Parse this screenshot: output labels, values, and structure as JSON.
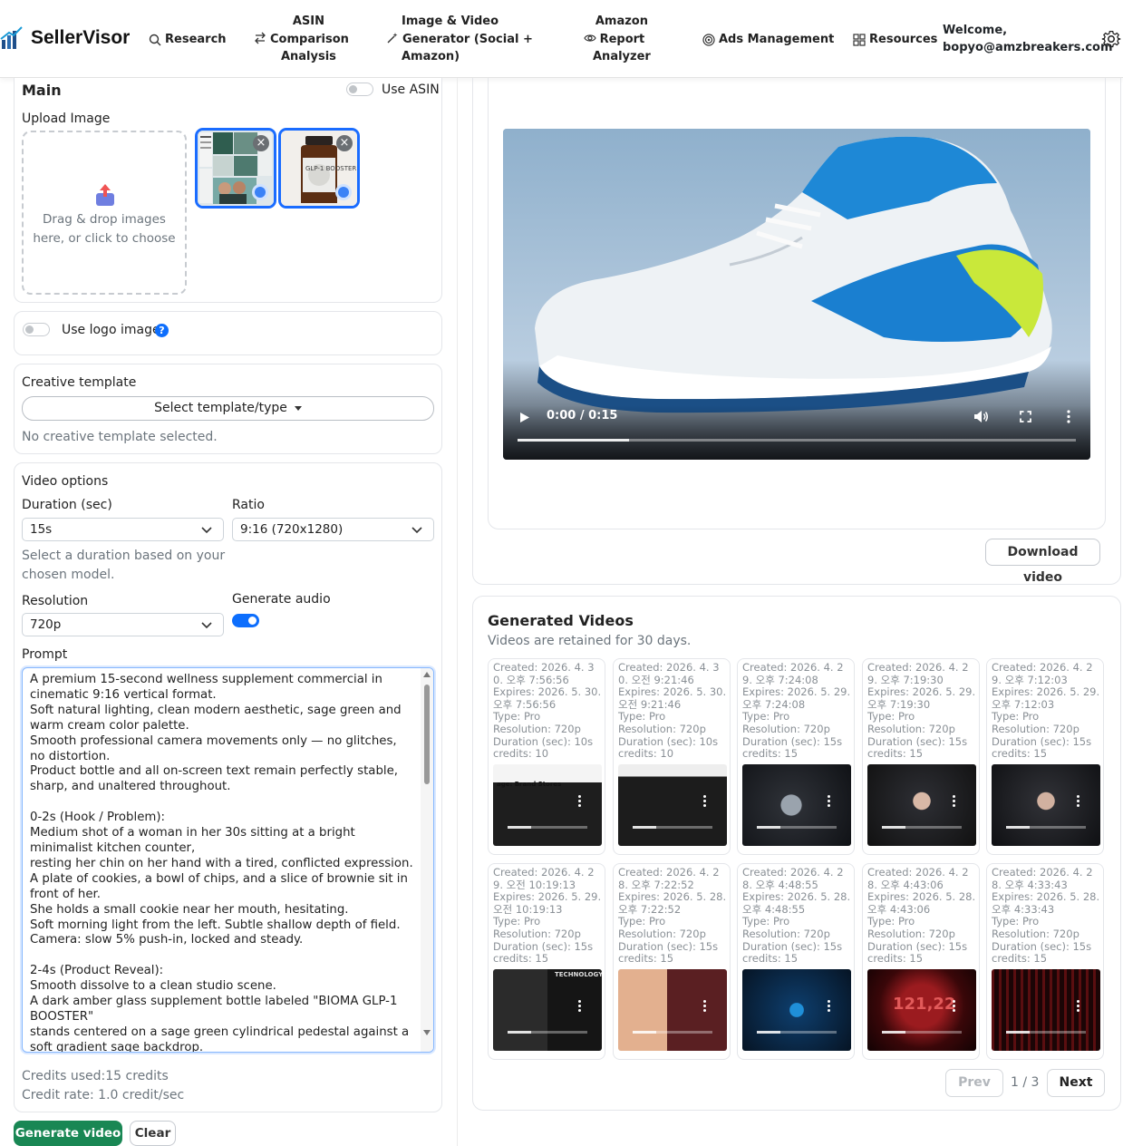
{
  "brand": {
    "name": "SellerVisor",
    "logo_text": "SellerVisor"
  },
  "nav": {
    "research": "Research",
    "asin_line1": "ASIN",
    "asin_line2": "Comparison",
    "asin_line3": "Analysis",
    "image_line1": "Image & Video",
    "image_line2": "Generator (Social +",
    "image_line3": "Amazon)",
    "report_line1": "Amazon",
    "report_line2": "Report",
    "report_line3": "Analyzer",
    "ads": "Ads Management",
    "resources": "Resources",
    "welcome_line1": "Welcome,",
    "welcome_line2": "bopyo@amzbreakers.com"
  },
  "main": {
    "title": "Main",
    "use_asin": "Use ASIN",
    "upload_label": "Upload Image",
    "drop_line1": "Drag & drop images",
    "drop_line2": "here, or click to choose",
    "thumb2_text": "GLP-1 BOOSTER"
  },
  "logo": {
    "label": "Use logo image",
    "help": "?"
  },
  "template": {
    "label": "Creative template",
    "button": "Select template/type",
    "status": "No creative template selected."
  },
  "video_options": {
    "title": "Video options",
    "duration_label": "Duration (sec)",
    "duration_value": "15s",
    "duration_help_line1": "Select a duration based on your",
    "duration_help_line2": "chosen model.",
    "ratio_label": "Ratio",
    "ratio_value": "9:16 (720x1280)",
    "resolution_label": "Resolution",
    "resolution_value": "720p",
    "audio_label": "Generate audio",
    "audio_on": true
  },
  "prompt": {
    "label": "Prompt",
    "text": "A premium 15-second wellness supplement commercial in cinematic 9:16 vertical format.\nSoft natural lighting, clean modern aesthetic, sage green and warm cream color palette.\nSmooth professional camera movements only — no glitches, no distortion.\nProduct bottle and all on-screen text remain perfectly stable, sharp, and unaltered throughout.\n\n0-2s (Hook / Problem):\nMedium shot of a woman in her 30s sitting at a bright minimalist kitchen counter,\nresting her chin on her hand with a tired, conflicted expression.\nA plate of cookies, a bowl of chips, and a slice of brownie sit in front of her.\nShe holds a small cookie near her mouth, hesitating.\nSoft morning light from the left. Subtle shallow depth of field.\nCamera: slow 5% push-in, locked and steady.\n\n2-4s (Product Reveal):\nSmooth dissolve to a clean studio scene.\nA dark amber glass supplement bottle labeled \"BIOMA GLP-1 BOOSTER\"\nstands centered on a sage green cylindrical pedestal against a soft gradient sage backdrop."
  },
  "credits": {
    "used": "Credits used:15 credits",
    "rate": "Credit rate: 1.0 credit/sec"
  },
  "actions": {
    "generate": "Generate video",
    "clear": "Clear"
  },
  "player": {
    "time": "0:00 / 0:15",
    "progress": 0.2,
    "download": "Download video"
  },
  "generated": {
    "title": "Generated Videos",
    "subtitle": "Videos are retained for 30 days.",
    "items": [
      {
        "meta": "Created: 2026. 4. 30. 오후 7:56:56\nExpires: 2026. 5. 30. 오후 7:56:56\nType: Pro\nResolution: 720p\nDuration (sec): 10s\ncredits: 10",
        "thumb_text": "age: Brand Stores"
      },
      {
        "meta": "Created: 2026. 4. 30. 오전 9:21:46\nExpires: 2026. 5. 30. 오전 9:21:46\nType: Pro\nResolution: 720p\nDuration (sec): 10s\ncredits: 10",
        "thumb_text": ""
      },
      {
        "meta": "Created: 2026. 4. 29. 오후 7:24:08\nExpires: 2026. 5. 29. 오후 7:24:08\nType: Pro\nResolution: 720p\nDuration (sec): 15s\ncredits: 15",
        "thumb_text": ""
      },
      {
        "meta": "Created: 2026. 4. 29. 오후 7:19:30\nExpires: 2026. 5. 29. 오후 7:19:30\nType: Pro\nResolution: 720p\nDuration (sec): 15s\ncredits: 15",
        "thumb_text": ""
      },
      {
        "meta": "Created: 2026. 4. 29. 오후 7:12:03\nExpires: 2026. 5. 29. 오후 7:12:03\nType: Pro\nResolution: 720p\nDuration (sec): 15s\ncredits: 15",
        "thumb_text": ""
      },
      {
        "meta": "Created: 2026. 4. 29. 오전 10:19:13\nExpires: 2026. 5. 29. 오전 10:19:13\nType: Pro\nResolution: 720p\nDuration (sec): 15s\ncredits: 15",
        "thumb_text": "TECHNOLOGY"
      },
      {
        "meta": "Created: 2026. 4. 28. 오후 7:22:52\nExpires: 2026. 5. 28. 오후 7:22:52\nType: Pro\nResolution: 720p\nDuration (sec): 15s\ncredits: 15",
        "thumb_text": ""
      },
      {
        "meta": "Created: 2026. 4. 28. 오후 4:48:55\nExpires: 2026. 5. 28. 오후 4:48:55\nType: Pro\nResolution: 720p\nDuration (sec): 15s\ncredits: 15",
        "thumb_text": ""
      },
      {
        "meta": "Created: 2026. 4. 28. 오후 4:43:06\nExpires: 2026. 5. 28. 오후 4:43:06\nType: Pro\nResolution: 720p\nDuration (sec): 15s\ncredits: 15",
        "thumb_text": "121,22"
      },
      {
        "meta": "Created: 2026. 4. 28. 오후 4:33:43\nExpires: 2026. 5. 28. 오후 4:33:43\nType: Pro\nResolution: 720p\nDuration (sec): 15s\ncredits: 15",
        "thumb_text": ""
      }
    ],
    "prev": "Prev",
    "page": "1 / 3",
    "next": "Next"
  },
  "colors": {
    "primary": "#0d6efd",
    "success": "#198754",
    "thumb_border": "#1a6cff"
  }
}
